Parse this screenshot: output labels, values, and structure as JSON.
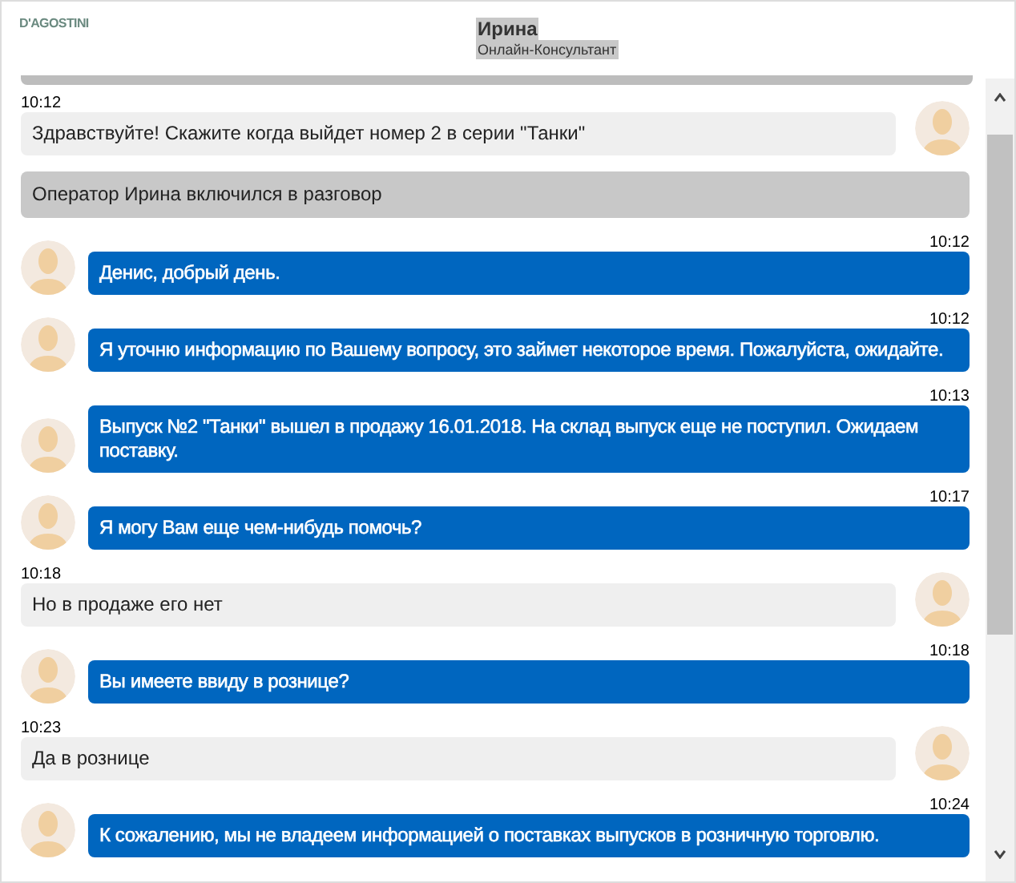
{
  "logo": "D'AGOSTINI",
  "operator": {
    "name": "Ирина",
    "role": "Онлайн-Консультант"
  },
  "messages": [
    {
      "kind": "client",
      "time": "10:12",
      "text": "Здравствуйте! Скажите когда выйдет номер 2 в серии \"Танки\""
    },
    {
      "kind": "system",
      "text": "Оператор Ирина включился в разговор"
    },
    {
      "kind": "operator",
      "time": "10:12",
      "text": "Денис, добрый день."
    },
    {
      "kind": "operator",
      "time": "10:12",
      "text": "Я уточню информацию по Вашему вопросу, это займет некоторое время. Пожалуйста, ожидайте."
    },
    {
      "kind": "operator",
      "time": "10:13",
      "text": "Выпуск №2 \"Танки\" вышел в продажу 16.01.2018. На склад выпуск еще не поступил. Ожидаем поставку."
    },
    {
      "kind": "operator",
      "time": "10:17",
      "text": "Я могу Вам еще чем-нибудь помочь?"
    },
    {
      "kind": "client",
      "time": "10:18",
      "text": "Но в продаже его нет"
    },
    {
      "kind": "operator",
      "time": "10:18",
      "text": "Вы имеете ввиду в рознице?"
    },
    {
      "kind": "client",
      "time": "10:23",
      "text": "Да в рознице"
    },
    {
      "kind": "operator",
      "time": "10:24",
      "text": "К сожалению, мы не владеем информацией о поставках выпусков в розничную торговлю."
    }
  ]
}
